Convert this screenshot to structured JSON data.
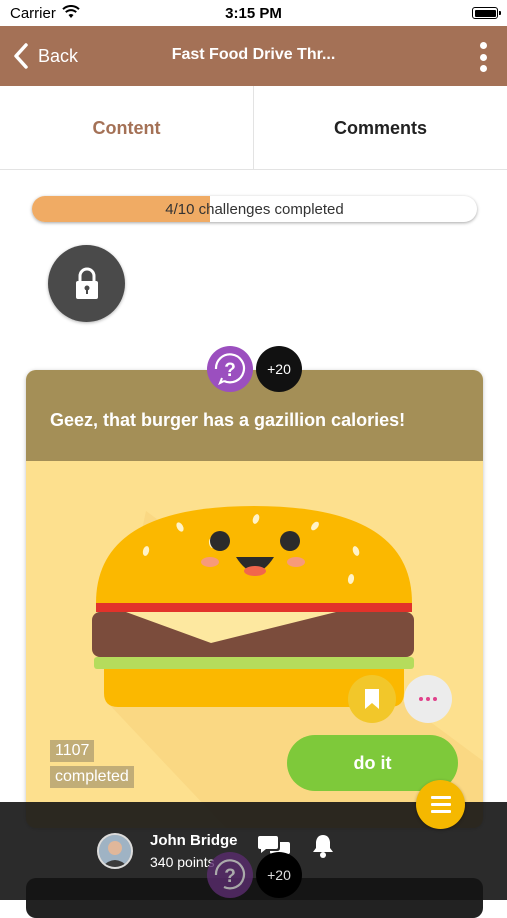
{
  "status_bar": {
    "carrier": "Carrier",
    "time": "3:15 PM"
  },
  "nav": {
    "back_label": "Back",
    "title": "Fast Food Drive Thr..."
  },
  "tabs": [
    {
      "label": "Content",
      "active": true
    },
    {
      "label": "Comments",
      "active": false
    }
  ],
  "progress": {
    "label": "4/10 challenges completed",
    "completed": 4,
    "total": 10,
    "fraction": 0.4
  },
  "challenge": {
    "points_badge": "+20",
    "title": "Geez, that burger has a gazillion calories!",
    "completed_count": "1107",
    "completed_label": "completed",
    "action_label": "do it"
  },
  "next_challenge": {
    "points_badge": "+20"
  },
  "user": {
    "name": "John Bridge",
    "points": "340 points"
  },
  "colors": {
    "brand": "#a47156",
    "progress_fill": "#f0ab64",
    "card_header": "#a48f57",
    "card_bg": "#fde08e",
    "action_green": "#7ec93a",
    "fab_yellow": "#f5b800",
    "question_purple": "#9b4fbf"
  },
  "icons": {
    "back": "chevron-left-icon",
    "more": "vertical-dots-icon",
    "lock": "lock-icon",
    "question": "question-mark-icon",
    "bookmark": "bookmark-icon",
    "menu": "hamburger-menu-icon",
    "chat": "chat-bubbles-icon",
    "bell": "bell-icon"
  }
}
